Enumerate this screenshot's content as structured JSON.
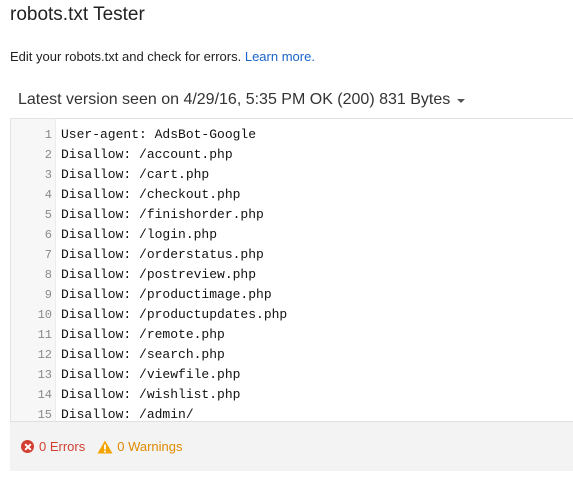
{
  "header": {
    "title": "robots.txt Tester",
    "description": "Edit your robots.txt and check for errors.",
    "learn_more": "Learn more."
  },
  "version": {
    "label": "Latest version seen on 4/29/16, 5:35 PM OK (200) 831 Bytes"
  },
  "editor": {
    "lines": [
      {
        "num": "1",
        "text": "User-agent: AdsBot-Google"
      },
      {
        "num": "2",
        "text": "Disallow: /account.php"
      },
      {
        "num": "3",
        "text": "Disallow: /cart.php"
      },
      {
        "num": "4",
        "text": "Disallow: /checkout.php"
      },
      {
        "num": "5",
        "text": "Disallow: /finishorder.php"
      },
      {
        "num": "6",
        "text": "Disallow: /login.php"
      },
      {
        "num": "7",
        "text": "Disallow: /orderstatus.php"
      },
      {
        "num": "8",
        "text": "Disallow: /postreview.php"
      },
      {
        "num": "9",
        "text": "Disallow: /productimage.php"
      },
      {
        "num": "10",
        "text": "Disallow: /productupdates.php"
      },
      {
        "num": "11",
        "text": "Disallow: /remote.php"
      },
      {
        "num": "12",
        "text": "Disallow: /search.php"
      },
      {
        "num": "13",
        "text": "Disallow: /viewfile.php"
      },
      {
        "num": "14",
        "text": "Disallow: /wishlist.php"
      },
      {
        "num": "15",
        "text": "Disallow: /admin/"
      }
    ]
  },
  "status": {
    "errors": "0 Errors",
    "warnings": "0 Warnings",
    "error_color": "#d23f31",
    "warning_color": "#e08a00",
    "error_icon": "error-circle-icon",
    "warning_icon": "warning-triangle-icon"
  }
}
